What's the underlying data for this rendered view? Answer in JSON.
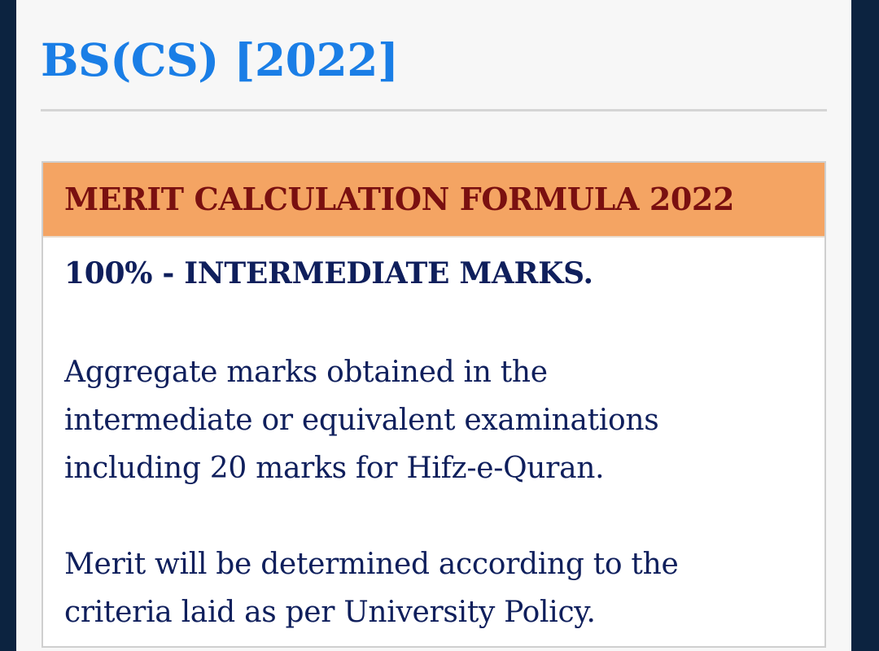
{
  "heading": "BS(CS) [2022]",
  "merit_card": {
    "title": "MERIT CALCULATION FORMULA 2022",
    "formula": "100% - INTERMEDIATE MARKS.",
    "paragraph_1": [
      "Aggregate marks obtained in the",
      "intermediate or equivalent examinations",
      "including 20 marks for Hifz-e-Quran."
    ],
    "paragraph_2": [
      "Merit will be determined according to the",
      "criteria laid as per University Policy."
    ]
  },
  "colors": {
    "heading": "#1a7ee6",
    "card_header_bg": "#f4a463",
    "card_title": "#7a1010",
    "body_text": "#0f1f5c",
    "side_bars": "#0c2340"
  }
}
